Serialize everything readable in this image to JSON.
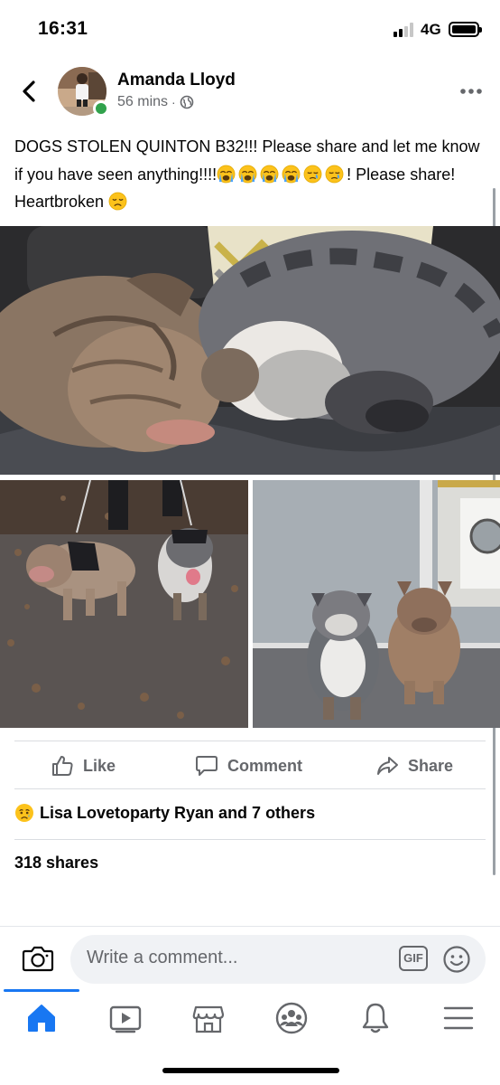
{
  "status_bar": {
    "time": "16:31",
    "network": "4G"
  },
  "post": {
    "author": "Amanda Lloyd",
    "time_ago": "56 mins",
    "separator": "·",
    "audience_icon": "globe-icon",
    "text_before_emojis": "DOGS STOLEN QUINTON B32!!! Please share and let me know if you have seen anything!!!!",
    "emojis": [
      "loudly-crying-face",
      "loudly-crying-face",
      "loudly-crying-face",
      "loudly-crying-face",
      "sleepy-face",
      "sleepy-face"
    ],
    "text_after_emojis": "! Please share! Heartbroken",
    "trailing_emoji": "disappointed-face",
    "photos": [
      {
        "id": "main",
        "alt_icon": "photo-sleeping-bulldogs"
      },
      {
        "id": "left",
        "alt_icon": "photo-bulldogs-walking"
      },
      {
        "id": "right",
        "alt_icon": "photo-bulldogs-sitting"
      }
    ]
  },
  "actions": {
    "like": "Like",
    "comment": "Comment",
    "share": "Share"
  },
  "reactions": {
    "reaction_icon": "sad-face-reaction",
    "text": "Lisa Lovetoparty Ryan and 7 others"
  },
  "shares": "318 shares",
  "composer": {
    "placeholder": "Write a comment...",
    "gif_label": "GIF"
  },
  "tabs": [
    {
      "name": "home",
      "icon": "home-icon",
      "active": true
    },
    {
      "name": "watch",
      "icon": "video-icon"
    },
    {
      "name": "marketplace",
      "icon": "marketplace-icon"
    },
    {
      "name": "groups",
      "icon": "groups-icon"
    },
    {
      "name": "notifications",
      "icon": "bell-icon"
    },
    {
      "name": "menu",
      "icon": "menu-icon"
    }
  ],
  "colors": {
    "accent": "#1877f2",
    "secondary_text": "#65676b",
    "online": "#31a24c"
  }
}
